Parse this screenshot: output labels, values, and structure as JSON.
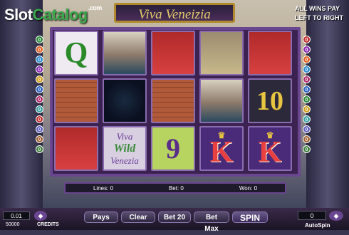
{
  "watermark": {
    "part1": "Slot",
    "part2": "Catalog",
    "suffix": ".com"
  },
  "title": "Viva Veneizia",
  "wins_note": {
    "line1": "ALL WINS PAY",
    "line2": "LEFT TO RIGHT"
  },
  "reels": [
    [
      {
        "type": "q",
        "label": "Q"
      },
      {
        "type": "gondola",
        "label": ""
      },
      {
        "type": "mask",
        "label": ""
      },
      {
        "type": "bells",
        "label": ""
      },
      {
        "type": "mask",
        "label": ""
      }
    ],
    [
      {
        "type": "hat",
        "label": ""
      },
      {
        "type": "beauty",
        "label": ""
      },
      {
        "type": "hat",
        "label": ""
      },
      {
        "type": "gondola",
        "label": ""
      },
      {
        "type": "ten",
        "label": "10"
      }
    ],
    [
      {
        "type": "mask",
        "label": ""
      },
      {
        "type": "wild",
        "label": "Viva Wild Venezia"
      },
      {
        "type": "nine",
        "label": "9"
      },
      {
        "type": "king",
        "label": "K"
      },
      {
        "type": "king",
        "label": "K"
      }
    ]
  ],
  "paylines_left": [
    {
      "num": "0",
      "color": "#2a8a3a"
    },
    {
      "num": "0",
      "color": "#e06020"
    },
    {
      "num": "0",
      "color": "#2a8ad0"
    },
    {
      "num": "0",
      "color": "#8a2ab0"
    },
    {
      "num": "0",
      "color": "#d0a020"
    },
    {
      "num": "0",
      "color": "#2a60c0"
    },
    {
      "num": "0",
      "color": "#b02a6a"
    },
    {
      "num": "0",
      "color": "#3aa0a0"
    },
    {
      "num": "0",
      "color": "#c03030"
    },
    {
      "num": "0",
      "color": "#6060c0"
    },
    {
      "num": "0",
      "color": "#a06030"
    },
    {
      "num": "0",
      "color": "#408040"
    }
  ],
  "paylines_right": [
    {
      "num": "0",
      "color": "#c03030"
    },
    {
      "num": "0",
      "color": "#8a2ab0"
    },
    {
      "num": "0",
      "color": "#e06020"
    },
    {
      "num": "0",
      "color": "#2a8ad0"
    },
    {
      "num": "0",
      "color": "#b02a6a"
    },
    {
      "num": "0",
      "color": "#2a60c0"
    },
    {
      "num": "0",
      "color": "#2a8a3a"
    },
    {
      "num": "0",
      "color": "#d0a020"
    },
    {
      "num": "0",
      "color": "#3aa0a0"
    },
    {
      "num": "0",
      "color": "#6060c0"
    },
    {
      "num": "0",
      "color": "#a06030"
    },
    {
      "num": "0",
      "color": "#408040"
    }
  ],
  "status": {
    "lines_label": "Lines:",
    "lines_value": "0",
    "bet_label": "Bet:",
    "bet_value": "0",
    "won_label": "Won:",
    "won_value": "0"
  },
  "controls": {
    "coin_value": "0.01",
    "credits_amount": "50000",
    "credits_label": "CREDITS",
    "pays": "Pays",
    "clear": "Clear",
    "bet20": "Bet 20",
    "betmax": "Bet Max",
    "spin": "SPIN",
    "counter": "0",
    "autospin": "AutoSpin"
  }
}
